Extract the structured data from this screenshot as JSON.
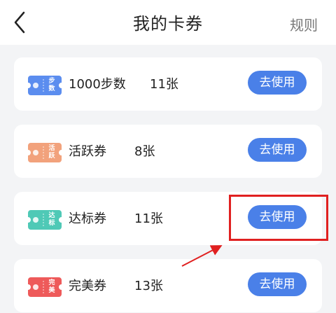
{
  "header": {
    "title": "我的卡券",
    "rules_label": "规则",
    "back_icon": "back-chevron-icon"
  },
  "cards": [
    {
      "icon_text": "步数",
      "name": "1000步数",
      "count": "11张",
      "button": "去使用",
      "color": "#5b8def"
    },
    {
      "icon_text": "活跃",
      "name": "活跃券",
      "count": "8张",
      "button": "去使用",
      "color": "#f2a27c"
    },
    {
      "icon_text": "达标",
      "name": "达标券",
      "count": "11张",
      "button": "去使用",
      "color": "#4fc9b6"
    },
    {
      "icon_text": "完美",
      "name": "完美券",
      "count": "13张",
      "button": "去使用",
      "color": "#ee5a5a"
    }
  ],
  "annotation": {
    "highlight_color": "#e02020",
    "target": "cards.2.button"
  }
}
